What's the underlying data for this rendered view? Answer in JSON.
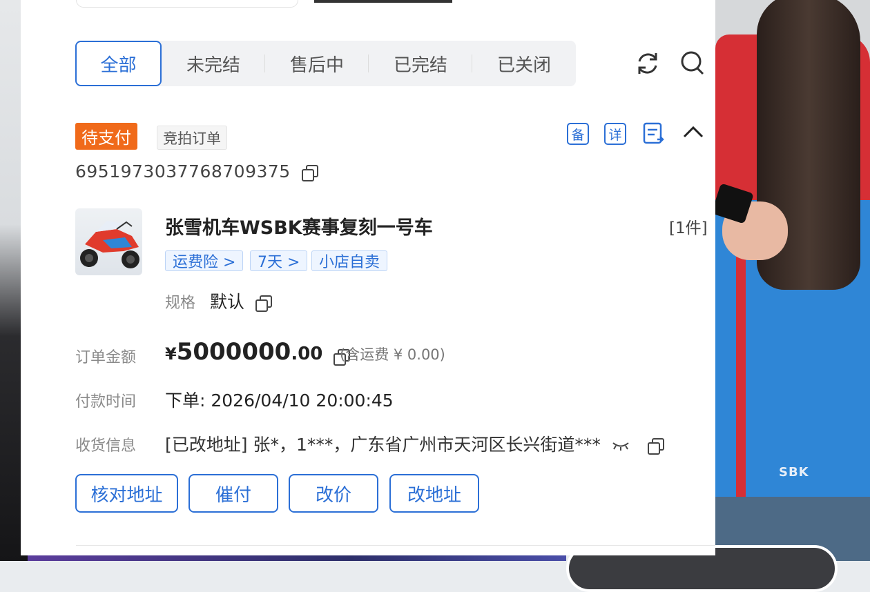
{
  "tabs": [
    {
      "label": "全部",
      "active": true
    },
    {
      "label": "未完结",
      "active": false
    },
    {
      "label": "售后中",
      "active": false
    },
    {
      "label": "已完结",
      "active": false
    },
    {
      "label": "已关闭",
      "active": false
    }
  ],
  "toolbar": {
    "refresh_icon": "refresh-icon",
    "search_icon": "search-icon"
  },
  "order": {
    "status": "待支付",
    "type": "竞拍订单",
    "actions": {
      "note": "备",
      "detail": "详",
      "record": "record-icon",
      "collapse": "chevron-up-icon"
    },
    "id": "6951973037768709375",
    "product": {
      "title": "张雪机车WSBK赛事复刻一号车",
      "quantity": "[1件]",
      "tags": [
        "运费险 >",
        "7天 >",
        "小店自卖"
      ],
      "spec_label": "规格",
      "spec_value": "默认"
    },
    "amount": {
      "label": "订单金额",
      "currency": "¥",
      "integer": "5000000",
      "decimal": ".00",
      "shipping_note": "(含运费 ¥ 0.00)"
    },
    "payment_time": {
      "label": "付款时间",
      "value": "下单: 2026/04/10 20:00:45"
    },
    "address": {
      "label": "收货信息",
      "value": "[已改地址] 张*，1***，广东省广州市天河区长兴街道***"
    },
    "buttons": [
      "核对地址",
      "催付",
      "改价",
      "改地址"
    ]
  },
  "colors": {
    "accent": "#2b6fd6",
    "status_orange": "#f06a1a"
  }
}
